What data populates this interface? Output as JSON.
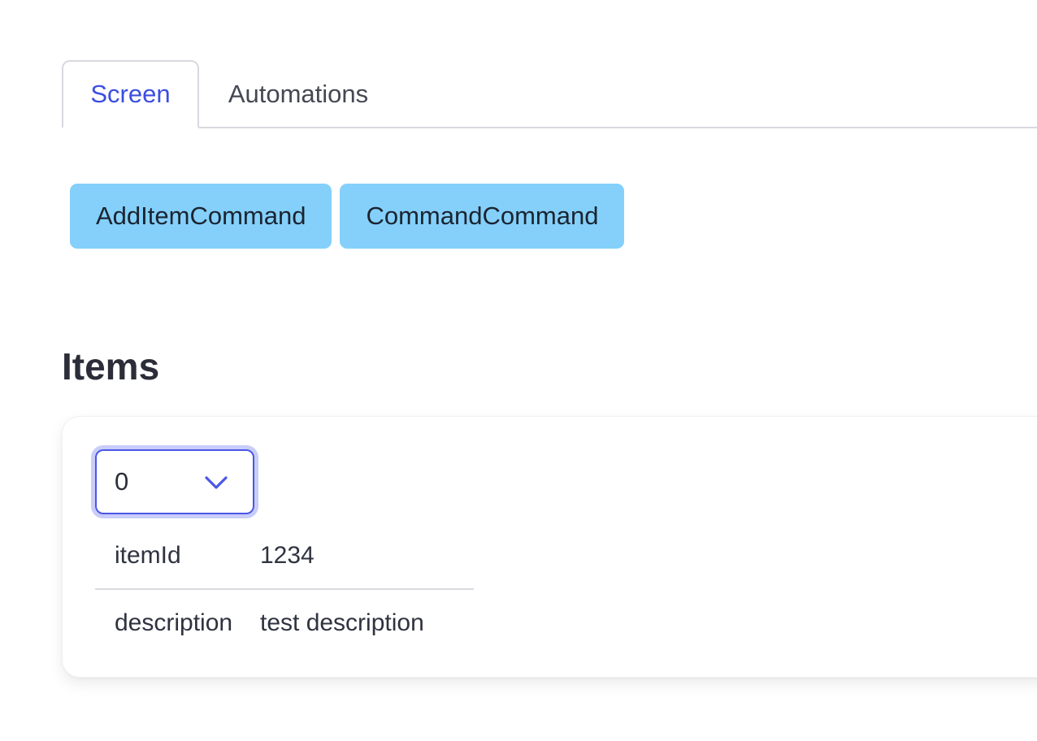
{
  "tabs": [
    {
      "label": "Screen",
      "active": true
    },
    {
      "label": "Automations",
      "active": false
    }
  ],
  "commands": [
    {
      "label": "AddItemCommand"
    },
    {
      "label": "CommandCommand"
    }
  ],
  "section": {
    "title": "Items"
  },
  "item_select": {
    "selected": "0"
  },
  "item_fields": [
    {
      "key": "itemId",
      "value": "1234"
    },
    {
      "key": "description",
      "value": "test description"
    }
  ],
  "colors": {
    "accent": "#3b4ee0",
    "button_bg": "#84d0fb",
    "select_border": "#4a57e6"
  }
}
